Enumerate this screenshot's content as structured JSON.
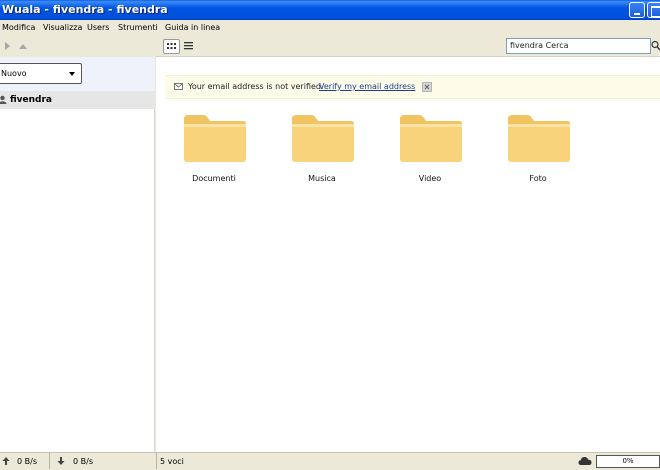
{
  "window": {
    "title": "Wuala - fivendra - fivendra"
  },
  "menu": {
    "items": [
      "Modifica",
      "Visualizza",
      "Users",
      "Strumenti",
      "Guida in linea"
    ]
  },
  "toolbar": {
    "search_value": "fivendra Cerca"
  },
  "sidebar": {
    "new_label": "Nuovo",
    "tree_item": "fivendra"
  },
  "notice": {
    "text": "Your email address is not verified.",
    "link": "Verify my email address"
  },
  "folders": [
    {
      "label": "Documenti"
    },
    {
      "label": "Musica"
    },
    {
      "label": "Video"
    },
    {
      "label": "Foto"
    }
  ],
  "status": {
    "upload": "0 B/s",
    "download": "0 B/s",
    "count": "5 voci",
    "progress": "0%"
  },
  "colors": {
    "title_bar": "#0054e3",
    "folder": "#f8d37c",
    "folder_tab": "#f0c461",
    "link": "#1d3c9a"
  }
}
